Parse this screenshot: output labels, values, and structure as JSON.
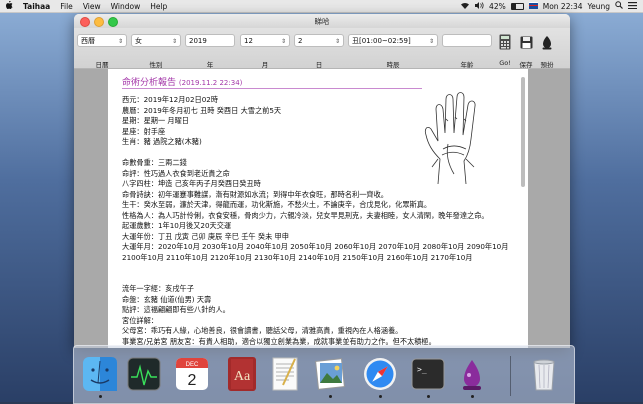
{
  "menubar": {
    "apple_icon": "apple-icon",
    "app_name": "Taihaa",
    "items": [
      "File",
      "View",
      "Window",
      "Help"
    ],
    "battery": "42%",
    "clock": "Mon 22:34",
    "user": "Yeung"
  },
  "window": {
    "title": "睇哈"
  },
  "toolbar": {
    "calendar": {
      "value": "西曆",
      "label": "日曆"
    },
    "gender": {
      "value": "女",
      "label": "性別"
    },
    "year": {
      "value": "2019",
      "label": "年"
    },
    "month": {
      "value": "12",
      "label": "月"
    },
    "day": {
      "value": "2",
      "label": "日"
    },
    "hour": {
      "value": "丑[01:00~02:59]",
      "label": "時辰"
    },
    "age": {
      "value": "",
      "label": "年齡"
    },
    "go_label": "Go!",
    "save_label": "保存",
    "predict_label": "預扮"
  },
  "report": {
    "title": "命術分析報告",
    "timestamp": "(2019.11.2 22:34)",
    "lines": [
      "西元：2019年12月02日02時",
      "農曆：2019年冬月初七 丑時 癸酉日 大雪之前5天",
      "星期：星期一 月曜日",
      "星座：射手座",
      "生肖：豬 過院之豬(木豬)",
      "",
      "命數骨重：三兩二錢",
      "      命評：性巧過人衣食到老近貴之命",
      "八字四柱：坤造 己亥年丙子月癸酉日癸丑時",
      "命骨詩訣：初年運蹇事難謀，漸有財源如水流；到得中年衣食旺，那時名利一齊收。",
      "      生干：癸水至弱，濂於天津，得龍而運，功化斯施，不愁火土，不論庚辛，合戊見化，化眾斯真。",
      "性格為人：為人巧計伶俐，衣食安穩，骨肉少力，六親冷淡，兒女早見刑克，夫妻相睦，女人清閑，晚年發達之命。",
      "起運歲數：1年10月後又20天交運",
      "大運年份：丁丑 戊寅 己卯 庚辰 辛巳 壬午 癸未 甲申",
      "大運年月：2020年10月 2030年10月 2040年10月 2050年10月 2060年10月 2070年10月 2080年10月 2090年10月",
      "              2100年10月 2110年10月 2120年10月 2130年10月 2140年10月 2150年10月 2160年10月 2170年10月",
      "",
      "",
      "流年一字經：亥戌午子",
      "命盤：玄豬 仙道(仙男) 天壽",
      "點評：這福翩翩即有些八針的人。",
      "宮位詳解：",
      "父母宮：乖巧有人緣，心地善良，很會讀書，聽話父母，清雅高貴，重視內在人格涵養。",
      "事業宮/兄弟宮 朋友宮：有貴人相助，適合以獨立創業為業，成就事業並有助力之作。但不太積極。"
    ]
  },
  "dock": {
    "items": [
      {
        "name": "finder-icon",
        "running": true
      },
      {
        "name": "activity-monitor-icon",
        "running": false
      },
      {
        "name": "calendar-icon",
        "running": false,
        "month": "DEC",
        "day": "2"
      },
      {
        "name": "dictionary-icon",
        "running": false
      },
      {
        "name": "textedit-icon",
        "running": false
      },
      {
        "name": "preview-icon",
        "running": true
      },
      {
        "name": "safari-icon",
        "running": true
      },
      {
        "name": "terminal-icon",
        "running": true
      },
      {
        "name": "taihaa-app-icon",
        "running": true
      },
      {
        "name": "trash-icon",
        "running": false
      }
    ]
  },
  "colors": {
    "accent": "#a336a8",
    "traffic_red": "#fc605c",
    "traffic_yellow": "#fdbc40",
    "traffic_green": "#34c84a"
  }
}
